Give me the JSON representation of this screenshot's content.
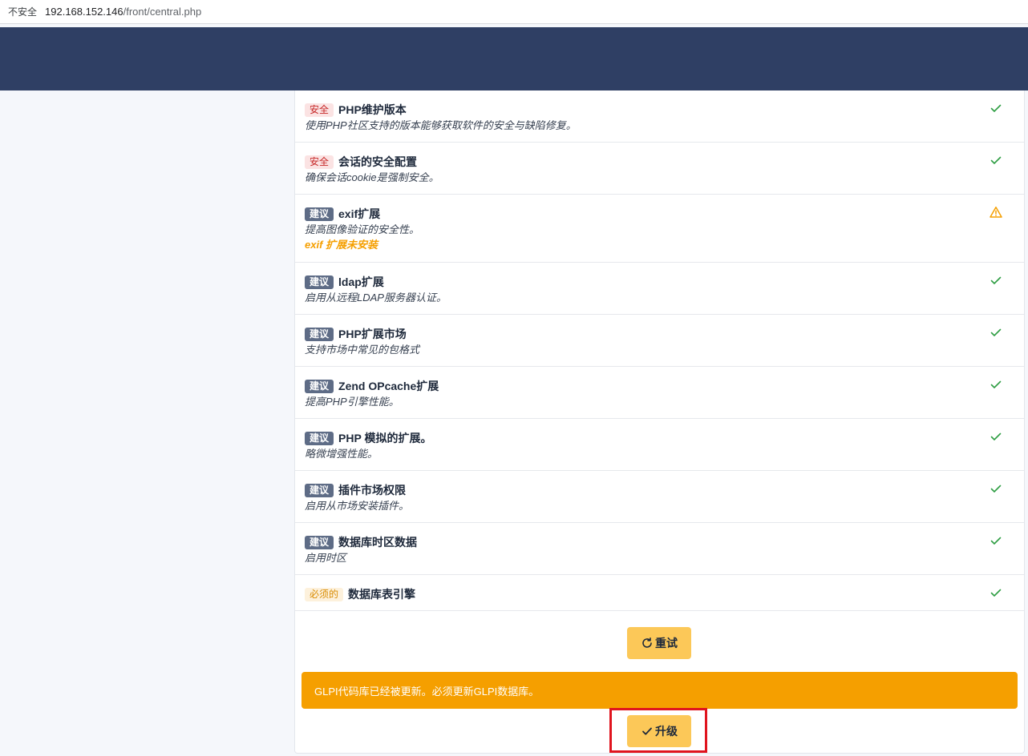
{
  "browser": {
    "insecure_label": "不安全",
    "url_host": "192.168.152.146",
    "url_path": "/front/central.php"
  },
  "requirements": [
    {
      "badge": "安全",
      "badge_type": "security",
      "title": "PHP维护版本",
      "desc": "使用PHP社区支持的版本能够获取软件的安全与缺陷修复。",
      "status": "ok"
    },
    {
      "badge": "安全",
      "badge_type": "security",
      "title": "会话的安全配置",
      "desc": "确保会话cookie是强制安全。",
      "status": "ok"
    },
    {
      "badge": "建议",
      "badge_type": "suggest",
      "title": "exif扩展",
      "desc": "提高图像验证的安全性。",
      "warning": "exif 扩展未安装",
      "status": "warning"
    },
    {
      "badge": "建议",
      "badge_type": "suggest",
      "title": "ldap扩展",
      "desc": "启用从远程LDAP服务器认证。",
      "status": "ok"
    },
    {
      "badge": "建议",
      "badge_type": "suggest",
      "title": "PHP扩展市场",
      "desc": "支持市场中常见的包格式",
      "status": "ok"
    },
    {
      "badge": "建议",
      "badge_type": "suggest",
      "title": "Zend OPcache扩展",
      "desc": "提高PHP引擎性能。",
      "status": "ok"
    },
    {
      "badge": "建议",
      "badge_type": "suggest",
      "title": "PHP 模拟的扩展。",
      "desc": "略微增强性能。",
      "status": "ok"
    },
    {
      "badge": "建议",
      "badge_type": "suggest",
      "title": "插件市场权限",
      "desc": "启用从市场安装插件。",
      "status": "ok"
    },
    {
      "badge": "建议",
      "badge_type": "suggest",
      "title": "数据库时区数据",
      "desc": "启用时区",
      "status": "ok"
    },
    {
      "badge": "必须的",
      "badge_type": "required",
      "title": "数据库表引擎",
      "desc": "",
      "status": "ok"
    }
  ],
  "actions": {
    "retry_label": "重试",
    "upgrade_label": "升级"
  },
  "alert_text": "GLPI代码库已经被更新。必须更新GLPI数据库。",
  "colors": {
    "header": "#2f3f64",
    "ok": "#2f9e44",
    "warning": "#f59f00",
    "button": "#fcc858",
    "highlight": "#e0141e"
  }
}
